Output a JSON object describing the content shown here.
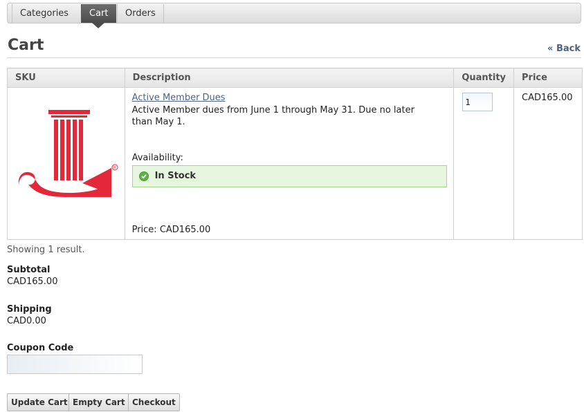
{
  "nav": {
    "tabs": [
      {
        "label": "Categories"
      },
      {
        "label": "Cart",
        "active": true
      },
      {
        "label": "Orders"
      }
    ]
  },
  "page": {
    "title": "Cart",
    "back_label": "« Back"
  },
  "table": {
    "headers": {
      "sku": "SKU",
      "description": "Description",
      "quantity": "Quantity",
      "price": "Price"
    },
    "rows": [
      {
        "logo_icon": "junior-league-logo",
        "name": "Active Member Dues",
        "description": "Active Member dues from June 1 through May 31. Due no later than May 1.",
        "availability_label": "Availability:",
        "stock_icon": "check-circle-icon",
        "stock_status": "In Stock",
        "price_line": "Price: CAD165.00",
        "quantity": "1",
        "price": "CAD165.00"
      }
    ]
  },
  "summary": {
    "result_count": "Showing 1 result.",
    "subtotal_label": "Subtotal",
    "subtotal_value": "CAD165.00",
    "shipping_label": "Shipping",
    "shipping_value": "CAD0.00",
    "coupon_label": "Coupon Code",
    "coupon_value": ""
  },
  "buttons": {
    "update": "Update Cart",
    "empty": "Empty Cart",
    "checkout": "Checkout"
  },
  "colors": {
    "brand_red": "#e3283a",
    "link": "#4b6386",
    "stock_bg": "#e7f7df",
    "stock_border": "#9cd98a"
  }
}
